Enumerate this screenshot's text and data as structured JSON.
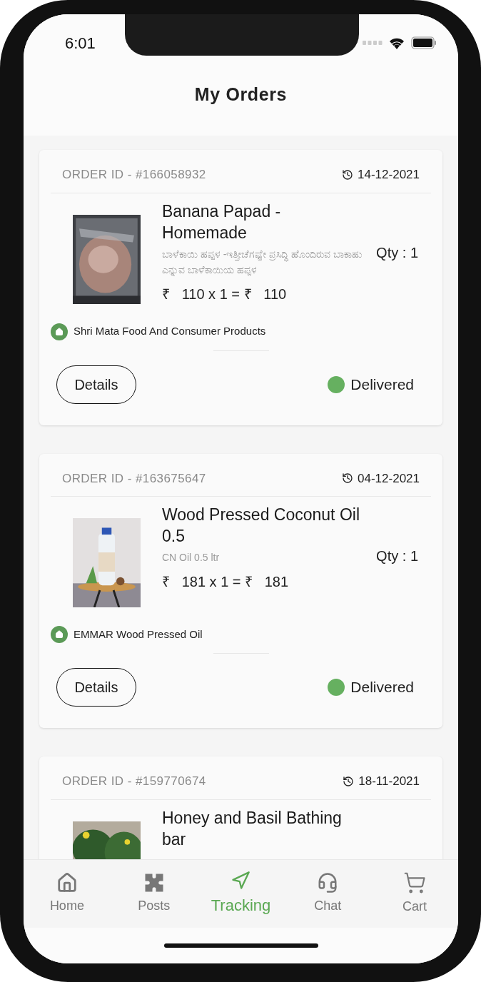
{
  "status_bar": {
    "time": "6:01"
  },
  "header": {
    "title": "My Orders"
  },
  "orders": [
    {
      "order_id": "ORDER ID - #166058932",
      "date": "14-12-2021",
      "title": "Banana Papad - Homemade",
      "description": "ಬಾಳೆಕಾಯಿ ಹಪ್ಪಳ -ಇತ್ತೀಚೆಗಷ್ಟೇ ಪ್ರಸಿದ್ಧಿ ಹೊಂದಿರುವ ಬಾಕಾಹು ಎನ್ನುವ ಬಾಳೆಕಾಯಿಯ ಹಪ್ಪಳ",
      "price": "₹   110 x 1 = ₹   110",
      "qty": "Qty : 1",
      "seller": "Shri Mata Food And Consumer Products",
      "button": "Details",
      "status": "Delivered"
    },
    {
      "order_id": "ORDER ID - #163675647",
      "date": "04-12-2021",
      "title": "Wood Pressed Coconut Oil 0.5",
      "description": "CN Oil 0.5 ltr",
      "price": "₹   181 x 1 = ₹   181",
      "qty": "Qty : 1",
      "seller": "EMMAR Wood Pressed Oil",
      "button": "Details",
      "status": "Delivered"
    },
    {
      "order_id": "ORDER ID - #159770674",
      "date": "18-11-2021",
      "title": "Honey and Basil Bathing bar"
    }
  ],
  "bottom_nav": [
    {
      "label": "Home",
      "selected": false
    },
    {
      "label": "Posts",
      "selected": false
    },
    {
      "label": "Tracking",
      "selected": true
    },
    {
      "label": "Chat",
      "selected": false
    },
    {
      "label": "Cart",
      "selected": false
    }
  ]
}
